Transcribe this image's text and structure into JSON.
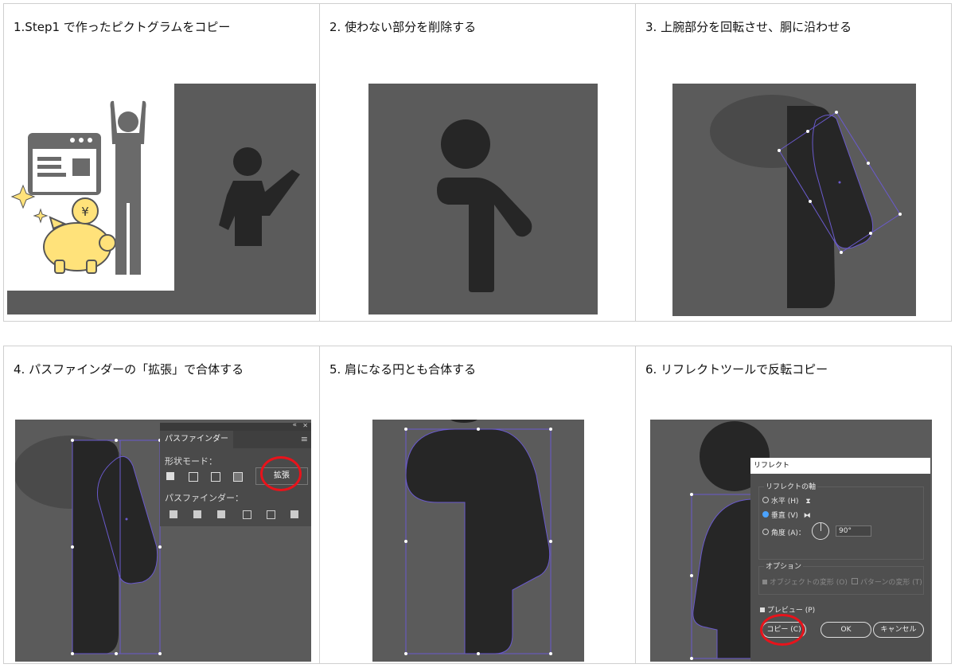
{
  "steps": [
    {
      "caption": "1.Step1 で作ったピクトグラムをコピー"
    },
    {
      "caption": "2. 使わない部分を削除する"
    },
    {
      "caption": "3. 上腕部分を回転させ、胴に沿わせる"
    },
    {
      "caption": "4. パスファインダーの「拡張」で合体する"
    },
    {
      "caption": "5. 肩になる円とも合体する"
    },
    {
      "caption": "6. リフレクトツールで反転コピー"
    }
  ],
  "pathfinder_panel": {
    "tab": "パスファインダー",
    "shape_modes_label": "形状モード：",
    "expand_button": "拡張",
    "pathfinders_label": "パスファインダー：",
    "collapse_icon": "«",
    "close_icon": "✕",
    "menu_icon": "≡"
  },
  "reflect_dialog": {
    "title": "リフレクト",
    "axis_label": "リフレクトの軸",
    "horizontal": "水平 (H)",
    "vertical": "垂直 (V)",
    "angle": "角度 (A)：",
    "angle_value": "90°",
    "options_label": "オプション",
    "transform_objects": "オブジェクトの変形 (O)",
    "transform_patterns": "パターンの変形 (T)",
    "preview": "プレビュー (P)",
    "copy_button": "コピー (C)",
    "ok_button": "OK",
    "cancel_button": "キャンセル"
  },
  "illustration": {
    "yen_symbol": "¥"
  },
  "colors": {
    "canvas": "#5b5b5b",
    "shape": "#262626",
    "selection": "#6a5acd",
    "highlight_circle": "#e8131b",
    "coin": "#ffe27a"
  }
}
